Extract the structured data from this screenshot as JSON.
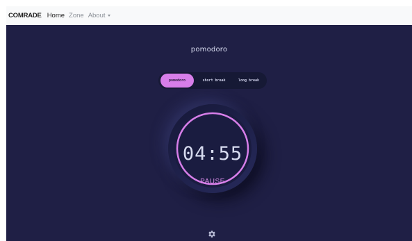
{
  "navbar": {
    "brand": "COMRADE",
    "links": [
      {
        "label": "Home"
      },
      {
        "label": "Zone"
      },
      {
        "label": "About"
      }
    ]
  },
  "app": {
    "title": "pomodoro",
    "modes": [
      {
        "label": "pomodoro",
        "active": true
      },
      {
        "label": "short break",
        "active": false
      },
      {
        "label": "long break",
        "active": false
      }
    ],
    "timer": {
      "time": "04:55",
      "action_label": "PAUSE",
      "progress": 1.0
    }
  },
  "icons": {
    "settings": "gear-icon",
    "about_dropdown": "caret-down-icon"
  },
  "colors": {
    "background": "#1f1f45",
    "accent": "#d77ee9",
    "text": "#d8dcf0",
    "navbar": "#f8f9fa"
  }
}
